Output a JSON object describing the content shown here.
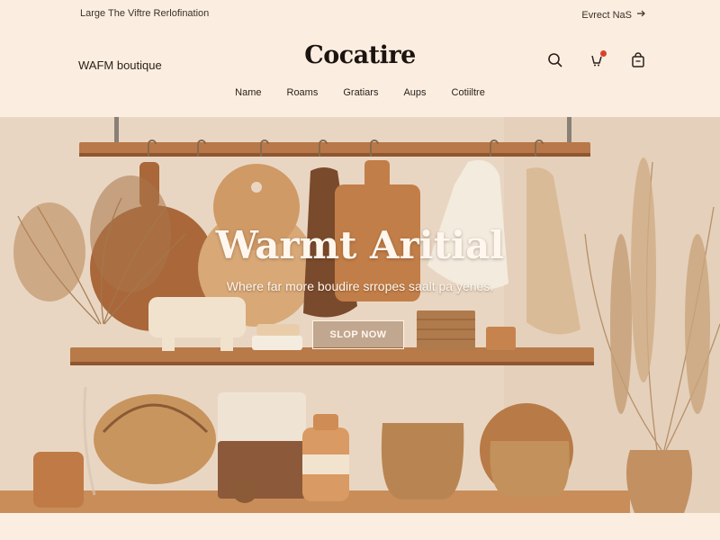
{
  "announcement": {
    "left_text": "Large The Viftre Rerlofination",
    "right_text": "Evrect NaS",
    "right_icon": "arrow-right-icon"
  },
  "header": {
    "tagline": "WAFM boutique",
    "logo": "Cocatire",
    "icons": [
      "search-icon",
      "notification-icon",
      "bag-icon"
    ],
    "notification_dot_color": "#d9412b"
  },
  "nav": {
    "items": [
      "Name",
      "Roams",
      "Gratiars",
      "Aups",
      "Cotiiltre"
    ]
  },
  "hero": {
    "title": "Warmt Aritial",
    "subtitle": "Where far more boudire srropes saalt pa yenes.",
    "cta_label": "SLOP NOW"
  },
  "colors": {
    "background": "#fbeee1",
    "wood": "#b77a48",
    "wall": "#e6d3bf",
    "text": "#2b211a"
  }
}
